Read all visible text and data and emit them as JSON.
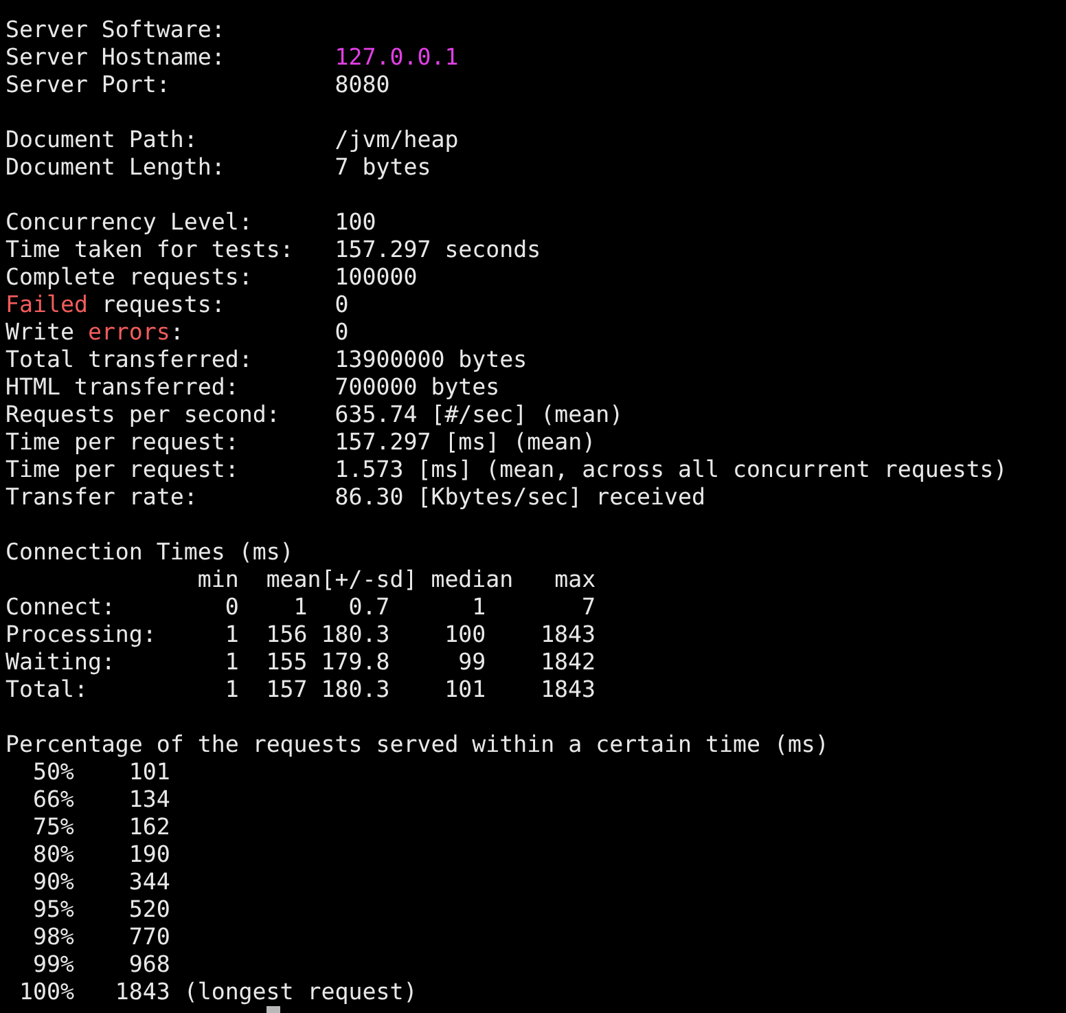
{
  "server": [
    {
      "label": [
        {
          "text": "Server Software:",
          "error": false
        }
      ]
    },
    {
      "label": [
        {
          "text": "Server Hostname:",
          "error": false
        }
      ],
      "value": "127.0.0.1",
      "highlighted": true
    },
    {
      "label": [
        {
          "text": "Server Port:",
          "error": false
        }
      ],
      "value": "8080",
      "highlighted": false
    }
  ],
  "document": [
    {
      "label": [
        {
          "text": "Document Path:",
          "error": false
        }
      ],
      "value": "/jvm/heap",
      "highlighted": false
    },
    {
      "label": [
        {
          "text": "Document Length:",
          "error": false
        }
      ],
      "value": "7 bytes",
      "highlighted": false
    }
  ],
  "results": [
    {
      "label": [
        {
          "text": "Concurrency Level:",
          "error": false
        }
      ],
      "value": "100",
      "highlighted": false
    },
    {
      "label": [
        {
          "text": "Time taken for tests:",
          "error": false
        }
      ],
      "value": "157.297 seconds",
      "highlighted": false
    },
    {
      "label": [
        {
          "text": "Complete requests:",
          "error": false
        }
      ],
      "value": "100000",
      "highlighted": false
    },
    {
      "label": [
        {
          "text": "Failed",
          "error": true
        },
        {
          "text": " requests:",
          "error": false
        }
      ],
      "value": "0",
      "highlighted": false
    },
    {
      "label": [
        {
          "text": "Write ",
          "error": false
        },
        {
          "text": "errors",
          "error": true
        },
        {
          "text": ":",
          "error": false
        }
      ],
      "value": "0",
      "highlighted": false
    },
    {
      "label": [
        {
          "text": "Total transferred:",
          "error": false
        }
      ],
      "value": "13900000 bytes",
      "highlighted": false
    },
    {
      "label": [
        {
          "text": "HTML transferred:",
          "error": false
        }
      ],
      "value": "700000 bytes",
      "highlighted": false
    },
    {
      "label": [
        {
          "text": "Requests per second:",
          "error": false
        }
      ],
      "value": "635.74 [#/sec] (mean)",
      "highlighted": false
    },
    {
      "label": [
        {
          "text": "Time per request:",
          "error": false
        }
      ],
      "value": "157.297 [ms] (mean)",
      "highlighted": false
    },
    {
      "label": [
        {
          "text": "Time per request:",
          "error": false
        }
      ],
      "value": "1.573 [ms] (mean, across all concurrent requests)",
      "highlighted": false
    },
    {
      "label": [
        {
          "text": "Transfer rate:",
          "error": false
        }
      ],
      "value": "86.30 [Kbytes/sec] received",
      "highlighted": false
    }
  ],
  "connection_times": {
    "title": "Connection Times (ms)",
    "columns": [
      "min",
      "mean[+/-sd]",
      "median",
      "max"
    ],
    "rows": [
      {
        "label": "Connect:",
        "min": "0",
        "mean": "1",
        "sd": "0.7",
        "median": "1",
        "max": "7"
      },
      {
        "label": "Processing:",
        "min": "1",
        "mean": "156",
        "sd": "180.3",
        "median": "100",
        "max": "1843"
      },
      {
        "label": "Waiting:",
        "min": "1",
        "mean": "155",
        "sd": "179.8",
        "median": "99",
        "max": "1842"
      },
      {
        "label": "Total:",
        "min": "1",
        "mean": "157",
        "sd": "180.3",
        "median": "101",
        "max": "1843"
      }
    ]
  },
  "percentiles": {
    "title": "Percentage of the requests served within a certain time (ms)",
    "rows": [
      {
        "percent": "50%",
        "time": "101"
      },
      {
        "percent": "66%",
        "time": "134"
      },
      {
        "percent": "75%",
        "time": "162"
      },
      {
        "percent": "80%",
        "time": "190"
      },
      {
        "percent": "90%",
        "time": "344"
      },
      {
        "percent": "95%",
        "time": "520"
      },
      {
        "percent": "98%",
        "time": "770"
      },
      {
        "percent": "99%",
        "time": "968"
      },
      {
        "percent": "100%",
        "time": "1843",
        "note": "(longest request)"
      }
    ]
  }
}
